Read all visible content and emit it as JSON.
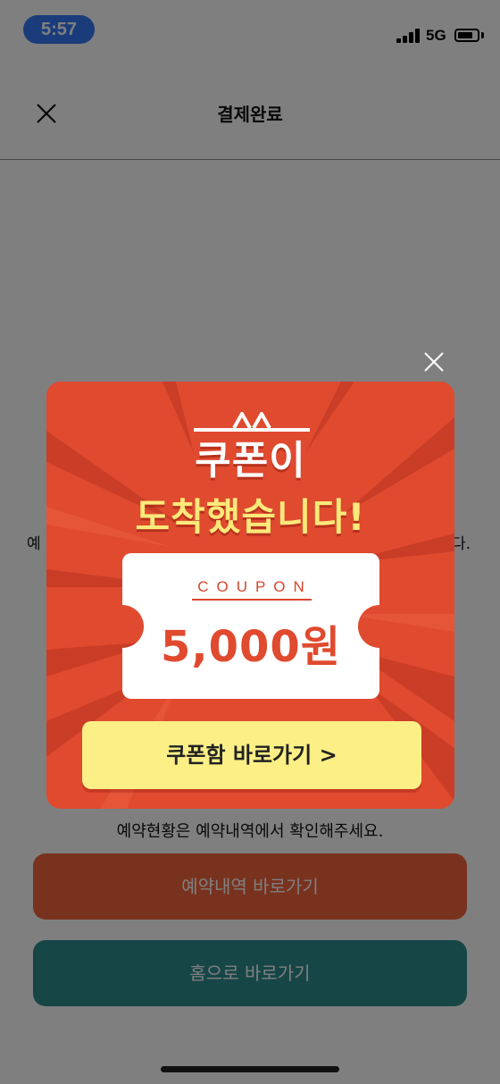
{
  "status_bar": {
    "time": "5:57",
    "network": "5G",
    "battery_level": 0.8
  },
  "header": {
    "title": "결제완료",
    "close_icon": "close-icon"
  },
  "body": {
    "text_left_fragment": "예",
    "text_right_fragment": "다.",
    "notice": "예약현황은 예약내역에서 확인해주세요."
  },
  "buttons": {
    "reservations_label": "예약내역 바로가기",
    "home_label": "홈으로 바로가기"
  },
  "popup": {
    "close_icon": "close-icon",
    "headline_1": "쿠폰이",
    "headline_2": "도착했습니다!",
    "coupon_label": "COUPON",
    "coupon_amount": "5,000원",
    "cta_label": "쿠폰함 바로가기 >"
  },
  "colors": {
    "popup_background": "#e04a2f",
    "headline_yellow": "#fbe97a",
    "cta_yellow": "#fbef86",
    "reservations_button": "#f2653d",
    "home_button": "#2f8c8f",
    "time_pill": "#3478f6"
  }
}
